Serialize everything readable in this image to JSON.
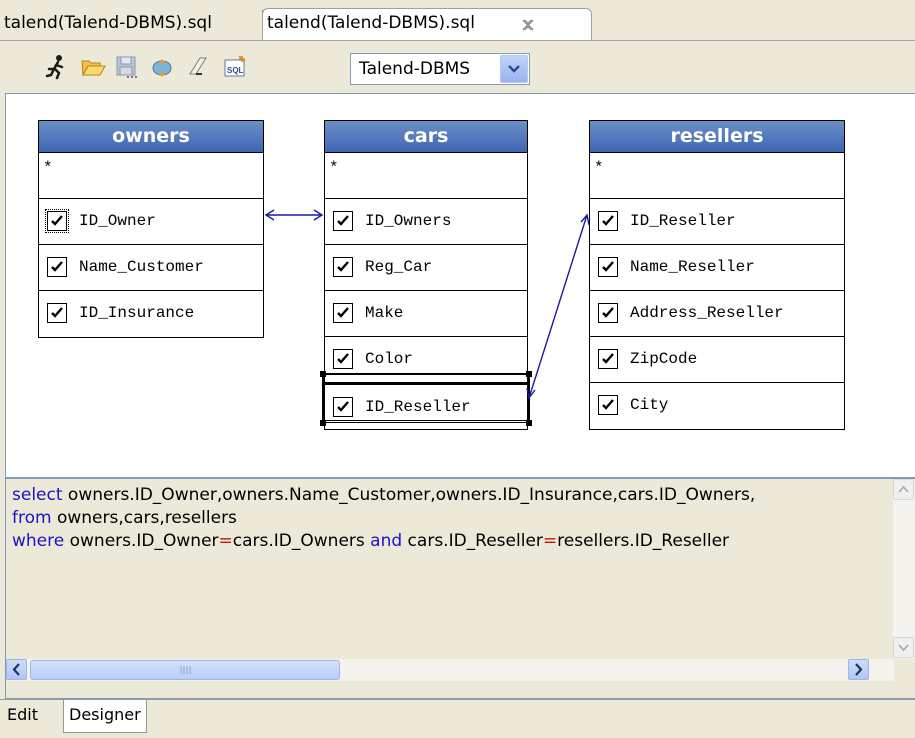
{
  "tabs": [
    "talend(Talend-DBMS).sql",
    "talend(Talend-DBMS).sql"
  ],
  "toolbar": {
    "icons": [
      "run-icon",
      "open-folder-icon",
      "save-icon",
      "refresh-icon",
      "clear-icon",
      "sql-builder-icon"
    ],
    "connection": "Talend-DBMS"
  },
  "tables": [
    {
      "name": "owners",
      "star": "*",
      "columns": [
        "ID_Owner",
        "Name_Customer",
        "ID_Insurance"
      ]
    },
    {
      "name": "cars",
      "star": "*",
      "columns": [
        "ID_Owners",
        "Reg_Car",
        "Make",
        "Color",
        "ID_Reseller"
      ]
    },
    {
      "name": "resellers",
      "star": "*",
      "columns": [
        "ID_Reseller",
        "Name_Reseller",
        "Address_Reseller",
        "ZipCode",
        "City"
      ]
    }
  ],
  "sql": {
    "line1_kw": "select",
    "line1_rest": " owners.ID_Owner,owners.Name_Customer,owners.ID_Insurance,cars.ID_Owners,",
    "line2_kw": "from",
    "line2_rest": " owners,cars,resellers",
    "line3_kw": "where",
    "line3_a": " owners.ID_Owner",
    "line3_eq1": "=",
    "line3_b": "cars.ID_Owners ",
    "line3_and": "and",
    "line3_c": " cars.ID_Reseller",
    "line3_eq2": "=",
    "line3_d": "resellers.ID_Reseller"
  },
  "bottom_tabs": [
    "Edit",
    "Designer"
  ],
  "colors": {
    "header_blue": "#3e66b4",
    "keyword": "#1d12c8",
    "operator": "#c81010",
    "link": "#1a1a9a"
  }
}
